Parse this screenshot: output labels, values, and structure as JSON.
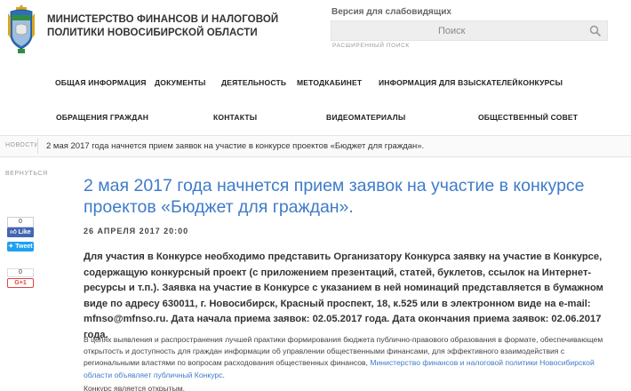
{
  "header": {
    "org_name": "МИНИСТЕРСТВО ФИНАНСОВ И НАЛОГОВОЙ ПОЛИТИКИ НОВОСИБИРСКОЙ ОБЛАСТИ",
    "vision_link": "Версия для слабовидящих",
    "search_placeholder": "Поиск",
    "advanced_search": "РАСШИРЕННЫЙ ПОИСК",
    "icons": {
      "logo": "novosibirsk-coat-of-arms",
      "search": "search-icon"
    }
  },
  "nav": {
    "row1": [
      "ОБЩАЯ ИНФОРМАЦИЯ",
      "ДОКУМЕНТЫ",
      "ДЕЯТЕЛЬНОСТЬ",
      "МЕТОДКАБИНЕТ",
      "ИНФОРМАЦИЯ ДЛЯ ВЗЫСКАТЕЛЕЙ",
      "КОНКУРСЫ"
    ],
    "row2": [
      "ОБРАЩЕНИЯ ГРАЖДАН",
      "КОНТАКТЫ",
      "ВИДЕОМАТЕРИАЛЫ",
      "ОБЩЕСТВЕННЫЙ СОВЕТ"
    ]
  },
  "breadcrumbs": {
    "root": "НОВОСТИ",
    "current": "2 мая 2017 года начнется прием заявок на участие в конкурсе проектов «Бюджет для граждан»."
  },
  "sidebar": {
    "back": "ВЕРНУТЬСЯ",
    "fb_count": "0",
    "fb_like": "Like",
    "tweet": "Tweet",
    "g_count": "0",
    "g_plus": "G+1"
  },
  "article": {
    "title": "2 мая 2017 года начнется прием заявок на участие в конкурсе проектов «Бюджет для граждан».",
    "date": "26 АПРЕЛЯ 2017 20:00",
    "lead": "Для участия в Конкурсе необходимо представить Организатору Конкурса заявку на участие в Конкурсе, содержащую конкурсный проект (с приложением презентаций, статей, буклетов, ссылок на Интернет-ресурсы и т.п.). Заявка на участие в Конкурсе с указанием в ней номинаций представляется в бумажном виде по адресу 630011, г. Новосибирск, Красный проспект, 18, к.525 или в электронном виде на e-mail: mfnso@mfnso.ru. Дата начала приема заявок: 02.05.2017 года. Дата окончания приема заявок: 02.06.2017 года.",
    "body_text": "В целях выявления и распространения лучшей практики формирования бюджета публично-правового образования в формате, обеспечивающем открытость и доступность для граждан информации об управлении общественными финансами, для эффективного взаимодействия с региональными властями по вопросам расходования общественных финансов, ",
    "body_link": "Министерство финансов и налоговой политики Новосибирской области объявляет публичный Конкурс",
    "body_end": ".",
    "body2": "Конкурс является открытым."
  }
}
